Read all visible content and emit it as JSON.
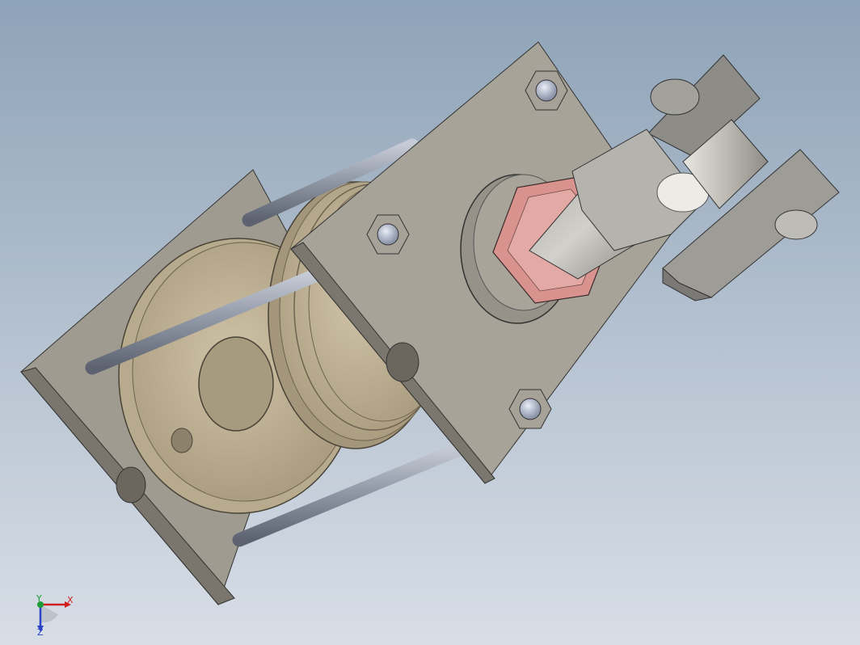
{
  "viewport": {
    "background_top": "#8ea3b8",
    "background_bottom": "#d8dee6"
  },
  "model": {
    "plate_color": "#a8a499",
    "plate_edge_color": "#6d6a62",
    "piston_color": "#b9ab90",
    "rod_color": "#8f96a4",
    "nut_color": "#d9938f",
    "clevis_color": "#a9a8a3"
  },
  "triad": {
    "x_label": "X",
    "y_label": "Y",
    "z_label": "Z",
    "x_color": "#d11f1f",
    "y_color": "#1e9d35",
    "z_color": "#2c43c8"
  }
}
